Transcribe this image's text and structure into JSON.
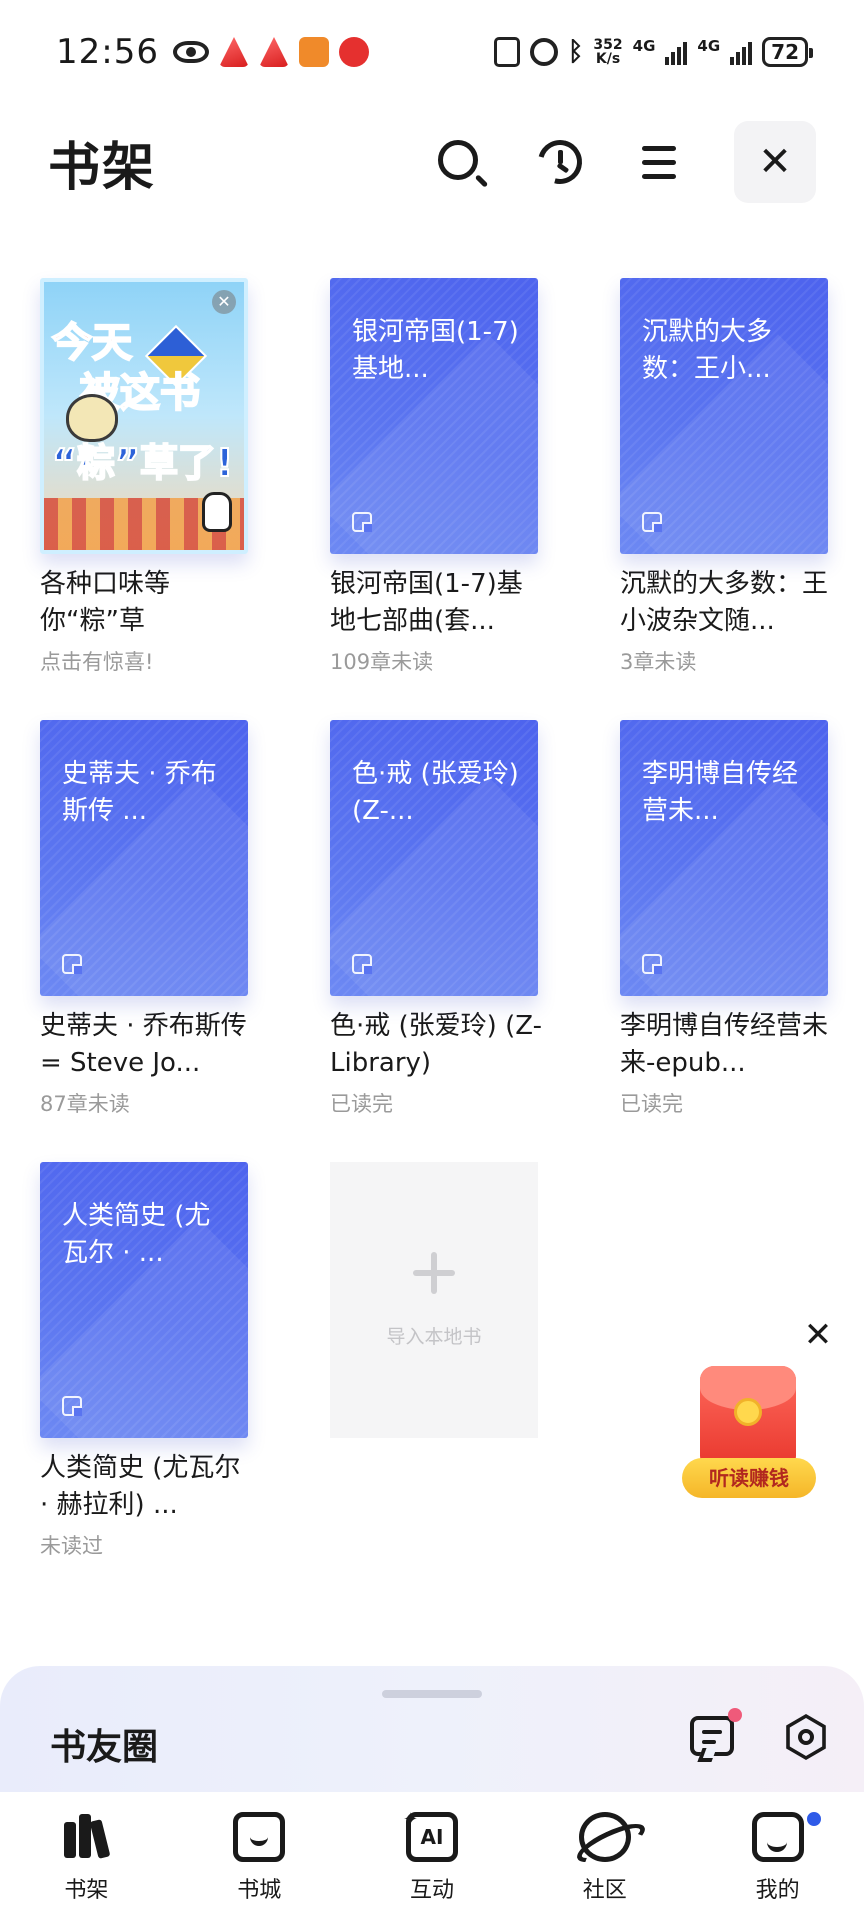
{
  "status_bar": {
    "time": "12:56",
    "net_speed_value": "352",
    "net_speed_unit": "K/s",
    "network_label_1": "4G",
    "network_label_2": "4G",
    "battery": "72",
    "icons": [
      "eye-icon",
      "app-icon",
      "app-icon",
      "app-icon",
      "app-icon",
      "nfc-icon",
      "alarm-icon",
      "bluetooth-icon",
      "signal-icon",
      "battery-icon"
    ]
  },
  "header": {
    "title": "书架",
    "actions": [
      "search-icon",
      "history-icon",
      "menu-icon",
      "close-icon"
    ],
    "close_glyph": "✕"
  },
  "books": [
    {
      "kind": "promo",
      "cover_lines": [
        "今天",
        "被这书",
        "“粽”草了!"
      ],
      "title": "各种口味等你“粽”草",
      "status": "点击有惊喜!"
    },
    {
      "kind": "book",
      "cover_title": "银河帝国(1-7)基地...",
      "title": "银河帝国(1-7)基地七部曲(套...",
      "status": "109章未读"
    },
    {
      "kind": "book",
      "cover_title": "沉默的大多数：王小...",
      "title": "沉默的大多数：王小波杂文随...",
      "status": "3章未读"
    },
    {
      "kind": "book",
      "cover_title": "史蒂夫 · 乔布斯传 ...",
      "title": "史蒂夫 · 乔布斯传 = Steve Jo...",
      "status": "87章未读"
    },
    {
      "kind": "book",
      "cover_title": "色·戒 (张爱玲) (Z-...",
      "title": "色·戒 (张爱玲) (Z-Library)",
      "status": "已读完"
    },
    {
      "kind": "book",
      "cover_title": "李明博自传经营未...",
      "title": "李明博自传经营未来-epub...",
      "status": "已读完"
    },
    {
      "kind": "book",
      "cover_title": "人类简史 (尤瓦尔 · ...",
      "title": "人类简史 (尤瓦尔 · 赫拉利) ...",
      "status": "未读过"
    }
  ],
  "import_card": {
    "label": "导入本地书"
  },
  "floating_reward": {
    "label": "听读赚钱",
    "close_glyph": "✕"
  },
  "social_bar": {
    "title": "书友圈"
  },
  "bottom_nav": [
    {
      "label": "书架",
      "icon": "bookshelf-icon"
    },
    {
      "label": "书城",
      "icon": "bookstore-icon"
    },
    {
      "label": "互动",
      "icon": "ai-icon"
    },
    {
      "label": "社区",
      "icon": "planet-icon"
    },
    {
      "label": "我的",
      "icon": "profile-icon"
    }
  ],
  "colors": {
    "cover_blue": "#5a74f0",
    "accent_dot": "#2f5be8",
    "reward_yellow": "#f5b629"
  }
}
